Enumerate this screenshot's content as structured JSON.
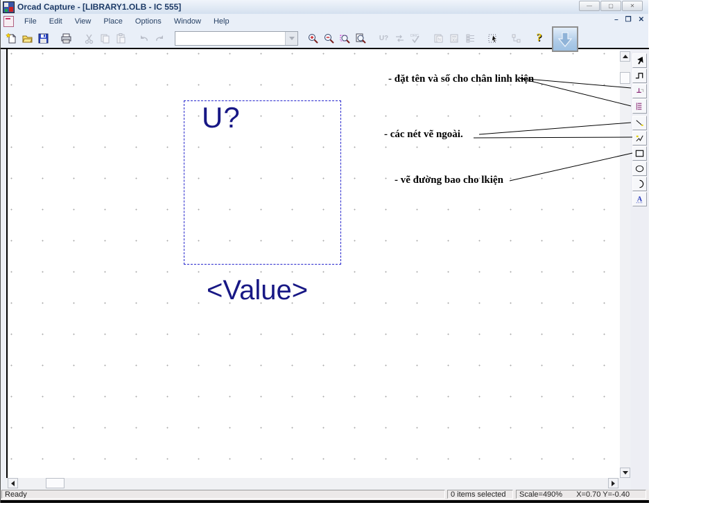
{
  "window": {
    "title": "Orcad Capture - [LIBRARY1.OLB - IC 555]",
    "controls": {
      "minimize": "—",
      "maximize": "▢",
      "close": "✕"
    }
  },
  "menu": {
    "items": [
      {
        "label": "File"
      },
      {
        "label": "Edit"
      },
      {
        "label": "View"
      },
      {
        "label": "Place"
      },
      {
        "label": "Options"
      },
      {
        "label": "Window"
      },
      {
        "label": "Help"
      }
    ],
    "child_controls": {
      "minimize": "–",
      "restore": "❐",
      "close": "✕"
    }
  },
  "toolbar": {
    "combo_value": "",
    "combo_placeholder": "",
    "icons": [
      "new",
      "open",
      "save",
      "print",
      "cut",
      "copy",
      "paste",
      "undo",
      "redo",
      "zoom-in",
      "zoom-out",
      "zoom-area",
      "zoom-all",
      "annotate",
      "back-annotate",
      "drc",
      "netlist",
      "cross-reference",
      "bom",
      "snap-to-grid",
      "hierarchy",
      "help"
    ],
    "annotate_glyph": "U?",
    "drc_glyph": "DRC"
  },
  "palette": {
    "tools": [
      "select",
      "ieee-symbol",
      "place-pin",
      "place-pin-array",
      "place-line",
      "place-polyline",
      "place-rectangle",
      "place-ellipse",
      "place-arc",
      "place-text"
    ],
    "text_tool_glyph": "A"
  },
  "canvas": {
    "part_reference": "U?",
    "part_value": "<Value>",
    "annotations": [
      {
        "text": "- đặt tên và số cho chân linh kiện"
      },
      {
        "text": "- các nét vẽ ngoài."
      },
      {
        "text": "- vẽ đường bao cho lkiện"
      }
    ]
  },
  "status": {
    "ready": "Ready",
    "selection": "0 items selected",
    "scale": "Scale=490%",
    "coords": "X=0.70 Y=-0.40"
  },
  "colors": {
    "part_text": "#181885",
    "dash_border": "#2323cc",
    "annotation_text": "#000000",
    "accent_navy": "#1d3a66"
  }
}
